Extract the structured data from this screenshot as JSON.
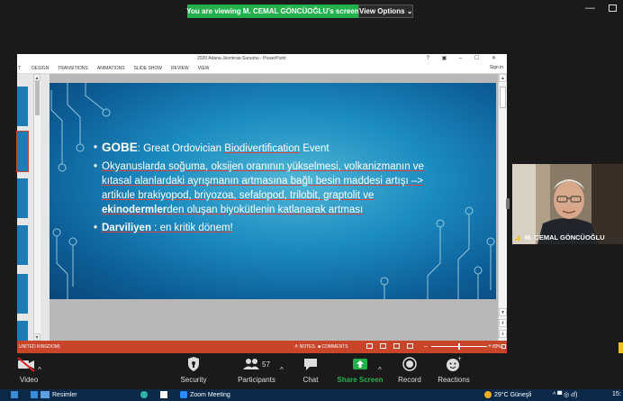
{
  "share_banner": {
    "viewing_text": "You are viewing M. CEMAL GÖNCÜOĞLU's screen",
    "view_options_label": "View Options ⌄"
  },
  "powerpoint": {
    "doc_title": "2020 Adana Jeomiras-Sunumu - PowerPoint",
    "title_icons": "? ▣ – ☐ ✕",
    "ribbon_tabs": [
      "T",
      "DESIGN",
      "TRANSITIONS",
      "ANIMATIONS",
      "SLIDE SHOW",
      "REVIEW",
      "VIEW"
    ],
    "sign_in": "Sign in",
    "status": {
      "language": "UNITED KINGDOM)",
      "notes": "≙ NOTES",
      "comments": "■ COMMENTS",
      "zoom_minus": "–",
      "zoom_plus": "+",
      "zoom_value": "89%"
    }
  },
  "slide": {
    "bullet1": {
      "head": "GOBE",
      "sep": ": Great Ordovician ",
      "underlined": "Biodivertification",
      "tail": " Event"
    },
    "bullet2": {
      "part1": "Okyanuslarda soğuma, oksijen oranının yükselmesi, volkanizmanın ve kıtasal alanlardaki ayrışmanın artmasına bağlı besin maddesi artışı –> artikule brakiyopod, briyozoa, sefalopod, trilobit, graptolit ve ",
      "bold": "ekinodermler",
      "part2": "den oluşan biyokütlenin katlanarak artması"
    },
    "bullet3": {
      "bold": "Darviliyen",
      "rest": " : en kritik dönem!"
    }
  },
  "participant": {
    "name": "M. CEMAL GÖNCÜOĞLU"
  },
  "toolbar": {
    "video_label": "Video",
    "security_label": "Security",
    "participants_label": "Participants",
    "participants_count": "57",
    "chat_label": "Chat",
    "share_label": "Share Screen",
    "record_label": "Record",
    "reactions_label": "Reactions",
    "caret": "^"
  },
  "taskbar": {
    "folder_label": "Resimler",
    "zoom_label": "Zoom Meeting",
    "weather": "29°C Güneşli",
    "tray": "^ ▀ ◎ ⅆ)",
    "time": "15:"
  },
  "colors": {
    "banner_green": "#23b14d",
    "pp_accent": "#c8452a",
    "share_green": "#23b14d",
    "slide_blue": "#1b8cc0"
  }
}
